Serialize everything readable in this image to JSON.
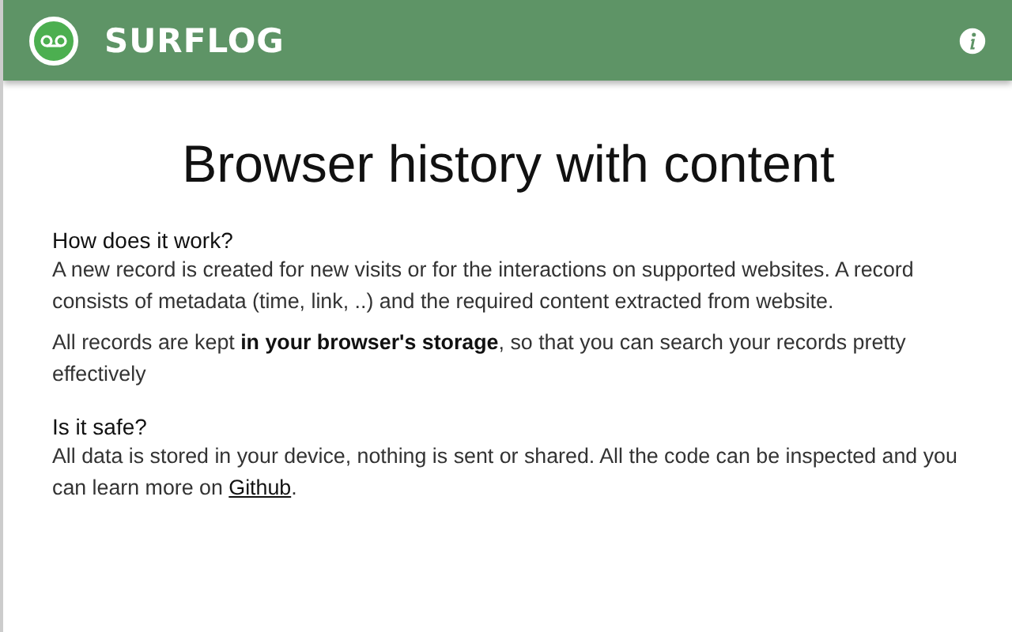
{
  "header": {
    "title": "SURFLOG"
  },
  "heading": "Browser history with content",
  "sections": [
    {
      "title": "How does it work?",
      "paragraphs": [
        [
          {
            "kind": "text",
            "text": "A new record is created for new visits or for the interactions on supported websites. A record consists of metadata (time, link, ..) and the required content extracted from website."
          }
        ],
        [
          {
            "kind": "text",
            "text": "All records are kept **in your browser's storage**, so that you can search your records pretty effectively"
          }
        ]
      ]
    },
    {
      "title": "Is it safe?",
      "paragraphs": [
        [
          {
            "kind": "text",
            "text": "All data is stored in your device, nothing is sent or shared. All the code can be inspected and you can learn more on "
          },
          {
            "kind": "link",
            "text": "Github"
          },
          {
            "kind": "text",
            "text": "."
          }
        ]
      ]
    }
  ]
}
